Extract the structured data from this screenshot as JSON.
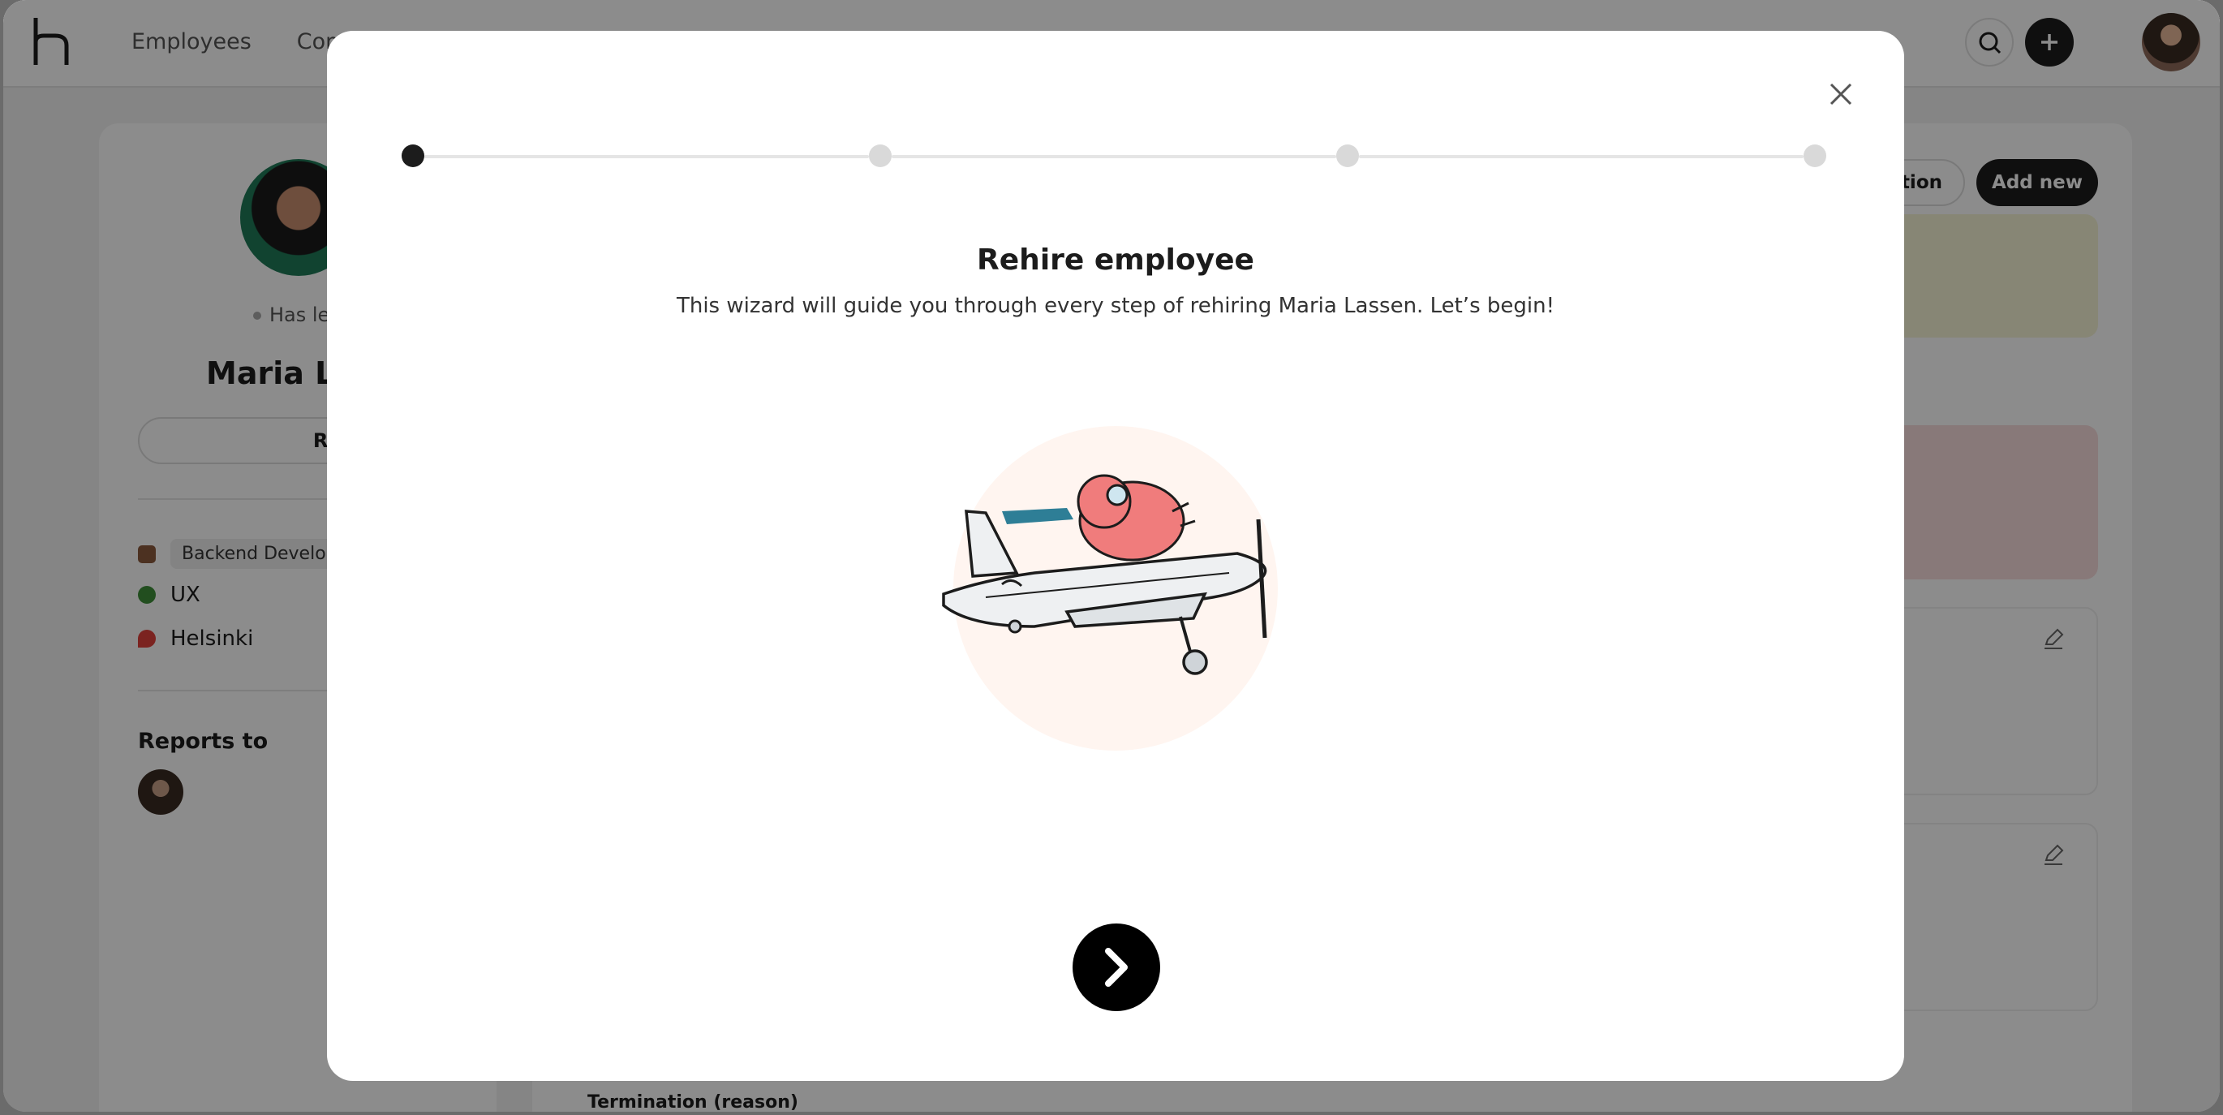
{
  "app": {
    "nav": [
      "Employees",
      "Com"
    ],
    "icons": {
      "search": "search-icon",
      "add": "plus-icon"
    }
  },
  "profile": {
    "status": "Has le",
    "name": "Maria La",
    "rehire_button": "Rehire",
    "details": [
      {
        "icon": "briefcase-icon",
        "label": "Backend Develope"
      },
      {
        "icon": "tree-icon",
        "label": "UX"
      },
      {
        "icon": "pin-icon",
        "label": "Helsinki"
      }
    ],
    "reports_to_title": "Reports to"
  },
  "main": {
    "action_button": "tion",
    "add_new_button": "Add new",
    "termination_label": "Termination (reason)"
  },
  "modal": {
    "title": "Rehire employee",
    "subtitle": "This wizard will guide you through every step of rehiring Maria Lassen. Let’s begin!",
    "steps": {
      "total": 4,
      "current": 1
    },
    "next_icon": "chevron-right-icon",
    "close_icon": "close-icon"
  },
  "colors": {
    "accent": "#1c1c1c",
    "illustration_bg": "#fff5f0",
    "pilot": "#f07c7c",
    "scarf": "#2e7e96"
  }
}
